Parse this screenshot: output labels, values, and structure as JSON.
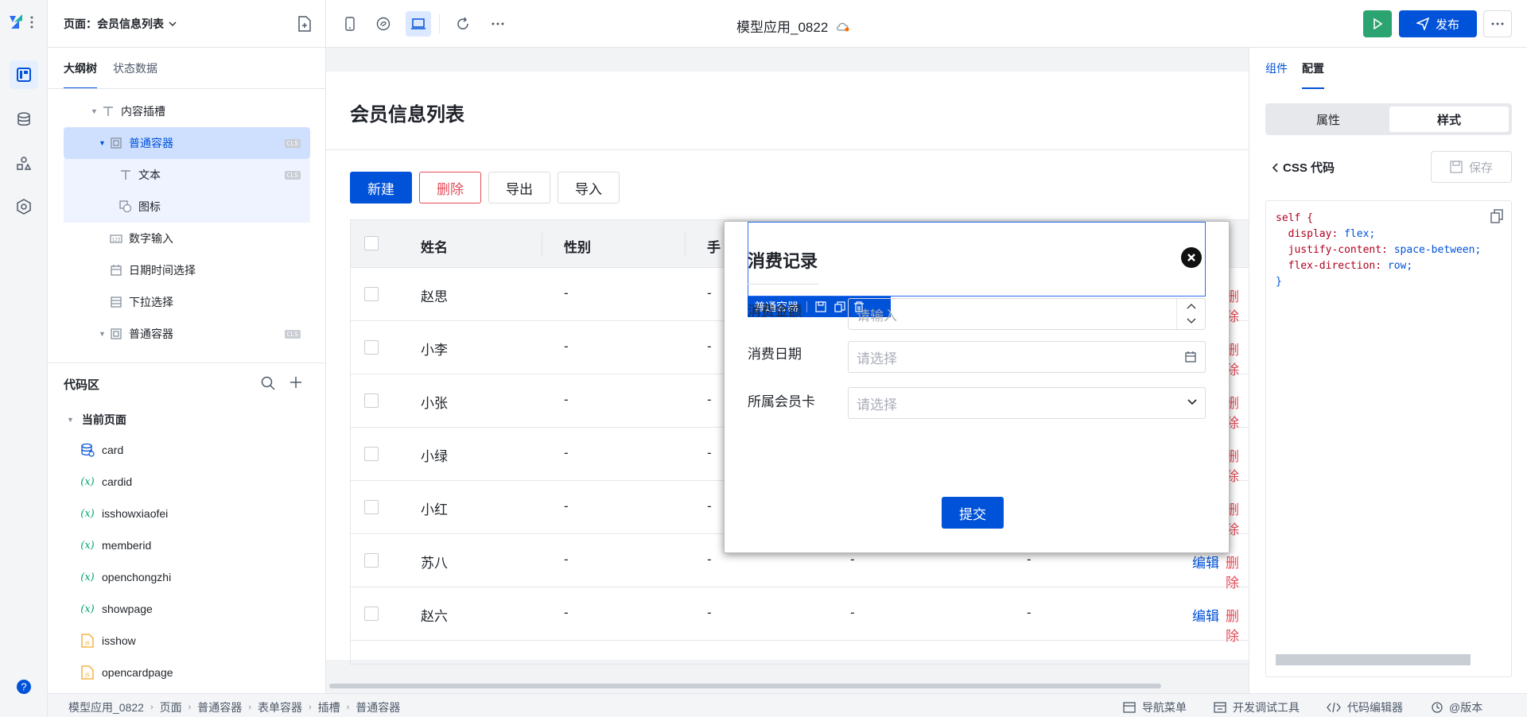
{
  "toolbar": {
    "page_selector_label": "页面：会员信息列表",
    "app_title": "模型应用_0822",
    "publish_label": "发布"
  },
  "left_panel": {
    "tabs": [
      "大纲树",
      "状态数据"
    ],
    "tree": [
      {
        "label": "内容插槽",
        "icon": "text-icon"
      },
      {
        "label": "普通容器",
        "icon": "container-icon",
        "badge": "CLS"
      },
      {
        "label": "文本",
        "icon": "text-icon",
        "badge": "CLS"
      },
      {
        "label": "图标",
        "icon": "image-icon"
      },
      {
        "label": "数字输入",
        "icon": "number-input-icon"
      },
      {
        "label": "日期时间选择",
        "icon": "calendar-icon"
      },
      {
        "label": "下拉选择",
        "icon": "list-icon"
      },
      {
        "label": "普通容器",
        "icon": "container-icon",
        "badge": "CLS"
      }
    ],
    "code_title": "代码区",
    "current_page": "当前页面",
    "code_items": [
      {
        "label": "card",
        "icon": "database-icon"
      },
      {
        "label": "cardid",
        "icon": "variable-icon"
      },
      {
        "label": "isshowxiaofei",
        "icon": "variable-icon"
      },
      {
        "label": "memberid",
        "icon": "variable-icon"
      },
      {
        "label": "openchongzhi",
        "icon": "variable-icon"
      },
      {
        "label": "showpage",
        "icon": "variable-icon"
      },
      {
        "label": "isshow",
        "icon": "js-file-icon"
      },
      {
        "label": "opencardpage",
        "icon": "js-file-icon"
      }
    ],
    "var_glyph": "(x)",
    "badge_text": "CLS"
  },
  "canvas": {
    "page_title": "会员信息列表",
    "buttons": {
      "new": "新建",
      "delete": "删除",
      "export": "导出",
      "import": "导入"
    },
    "columns": [
      "姓名",
      "性别",
      "手"
    ],
    "rows": [
      {
        "name": "赵思",
        "gender": "-",
        "phone": "-"
      },
      {
        "name": "小李",
        "gender": "-",
        "phone": "-"
      },
      {
        "name": "小张",
        "gender": "-",
        "phone": "-"
      },
      {
        "name": "小绿",
        "gender": "-",
        "phone": "-"
      },
      {
        "name": "小红",
        "gender": "-",
        "phone": "-"
      },
      {
        "name": "苏八",
        "gender": "-",
        "phone": "-",
        "c4": "-",
        "c5": "-",
        "edit": "编辑",
        "del": "删除"
      },
      {
        "name": "赵六",
        "gender": "-",
        "phone": "-",
        "c4": "-",
        "c5": "-",
        "edit": "编辑",
        "del": "删除"
      }
    ],
    "row_del_label": "删除"
  },
  "modal": {
    "title": "消费记录",
    "selection_label": "普通容器",
    "fields": [
      {
        "label": "消费金额",
        "placeholder": "请输入"
      },
      {
        "label": "消费日期",
        "placeholder": "请选择"
      },
      {
        "label": "所属会员卡",
        "placeholder": "请选择"
      }
    ],
    "submit_label": "提交"
  },
  "right_panel": {
    "tabs": [
      "组件",
      "配置"
    ],
    "segment": [
      "属性",
      "样式"
    ],
    "css_title": "CSS 代码",
    "save_label": "保存",
    "code_lines": [
      {
        "k": "self {",
        "v": ""
      },
      {
        "k": "  display:",
        "v": " flex;"
      },
      {
        "k": "  justify-content:",
        "v": " space-between;"
      },
      {
        "k": "  flex-direction:",
        "v": " row;"
      },
      {
        "k": "}",
        "v": ""
      }
    ]
  },
  "status_bar": {
    "breadcrumb": [
      "模型应用_0822",
      "页面",
      "普通容器",
      "表单容器",
      "插槽",
      "普通容器"
    ],
    "nav_menu": "导航菜单",
    "dev_tools": "开发调试工具",
    "code_editor": "代码编辑器",
    "version": "@版本"
  },
  "colors": {
    "primary": "#0052d9",
    "danger": "#e34d59",
    "success": "#2ba471"
  }
}
